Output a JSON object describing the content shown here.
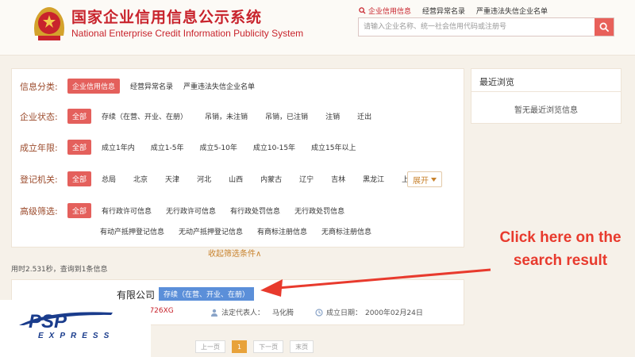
{
  "header": {
    "title_cn": "国家企业信用信息公示系统",
    "title_en": "National Enterprise Credit Information Publicity System",
    "tabs": [
      {
        "label": "企业信用信息",
        "active": true
      },
      {
        "label": "经营异常名录",
        "active": false
      },
      {
        "label": "严重违法失信企业名单",
        "active": false
      }
    ],
    "search_placeholder": "请输入企业名称、统一社会信用代码或注册号"
  },
  "filters": {
    "category": {
      "label": "信息分类:",
      "options": [
        "企业信用信息",
        "经营异常名录",
        "严重违法失信企业名单"
      ]
    },
    "status": {
      "label": "企业状态:",
      "options": [
        "全部",
        "存续（在营、开业、在册）",
        "吊销，未注销",
        "吊销，已注销",
        "注销",
        "迁出"
      ]
    },
    "age": {
      "label": "成立年限:",
      "options": [
        "全部",
        "成立1年内",
        "成立1-5年",
        "成立5-10年",
        "成立10-15年",
        "成立15年以上"
      ]
    },
    "authority": {
      "label": "登记机关:",
      "options": [
        "全部",
        "总局",
        "北京",
        "天津",
        "河北",
        "山西",
        "内蒙古",
        "辽宁",
        "吉林",
        "黑龙江",
        "上海"
      ],
      "expand_label": "展开"
    },
    "advanced": {
      "label": "高级筛选:",
      "row1": [
        "全部",
        "有行政许可信息",
        "无行政许可信息",
        "有行政处罚信息",
        "无行政处罚信息"
      ],
      "row2": [
        "有动产抵押登记信息",
        "无动产抵押登记信息",
        "有商标注册信息",
        "无商标注册信息"
      ]
    },
    "collapse_label": "收起筛选条件∧"
  },
  "recent": {
    "title": "最近浏览",
    "empty": "暂无最近浏览信息"
  },
  "results": {
    "summary": "用时2.531秒，查询到1条信息",
    "card": {
      "name": "有限公司",
      "status": "存续（在营、开业、在册）",
      "code": "26726XG",
      "rep_label": "法定代表人：",
      "rep_value": "马化腾",
      "date_label": "成立日期：",
      "date_value": "2000年02月24日"
    }
  },
  "pager": {
    "prev": "上一页",
    "current": "1",
    "next": "下一页",
    "last": "末页"
  },
  "annotation": {
    "text": "Click here on the search result",
    "color": "#e83a2d"
  },
  "logo": {
    "main": "PSP",
    "sub": "EXPRESS"
  },
  "colors": {
    "brand_red": "#c8232c",
    "selected_chip": "#e4605c",
    "status_blue": "#5b8fd9",
    "accent_orange": "#c8822c",
    "logo_blue": "#1a3c8c"
  }
}
